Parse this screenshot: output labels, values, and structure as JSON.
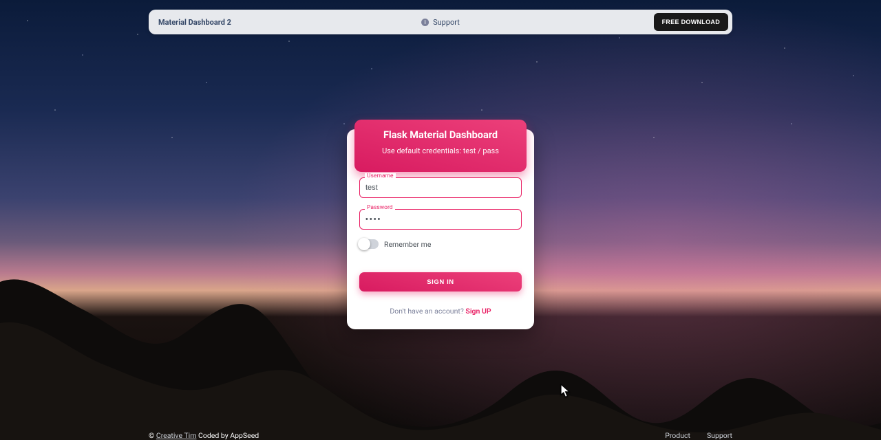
{
  "topbar": {
    "brand": "Material Dashboard 2",
    "support_label": "Support",
    "download_label": "FREE DOWNLOAD"
  },
  "login": {
    "title": "Flask Material Dashboard",
    "subtitle": "Use default credentials: test / pass",
    "username_label": "Username",
    "username_value": "test",
    "password_label": "Password",
    "password_value": "pass",
    "remember_label": "Remember me",
    "remember_checked": false,
    "signin_label": "SIGN IN",
    "prompt_text": "Don't have an account? ",
    "signup_label": "Sign UP"
  },
  "footer": {
    "copyright_prefix": "© ",
    "creative_tim": "Creative Tim",
    "coded_by": " Coded by AppSeed",
    "links": {
      "product": "Product",
      "support": "Support"
    }
  },
  "colors": {
    "accent": "#e91e63",
    "brand_text": "#344767"
  }
}
